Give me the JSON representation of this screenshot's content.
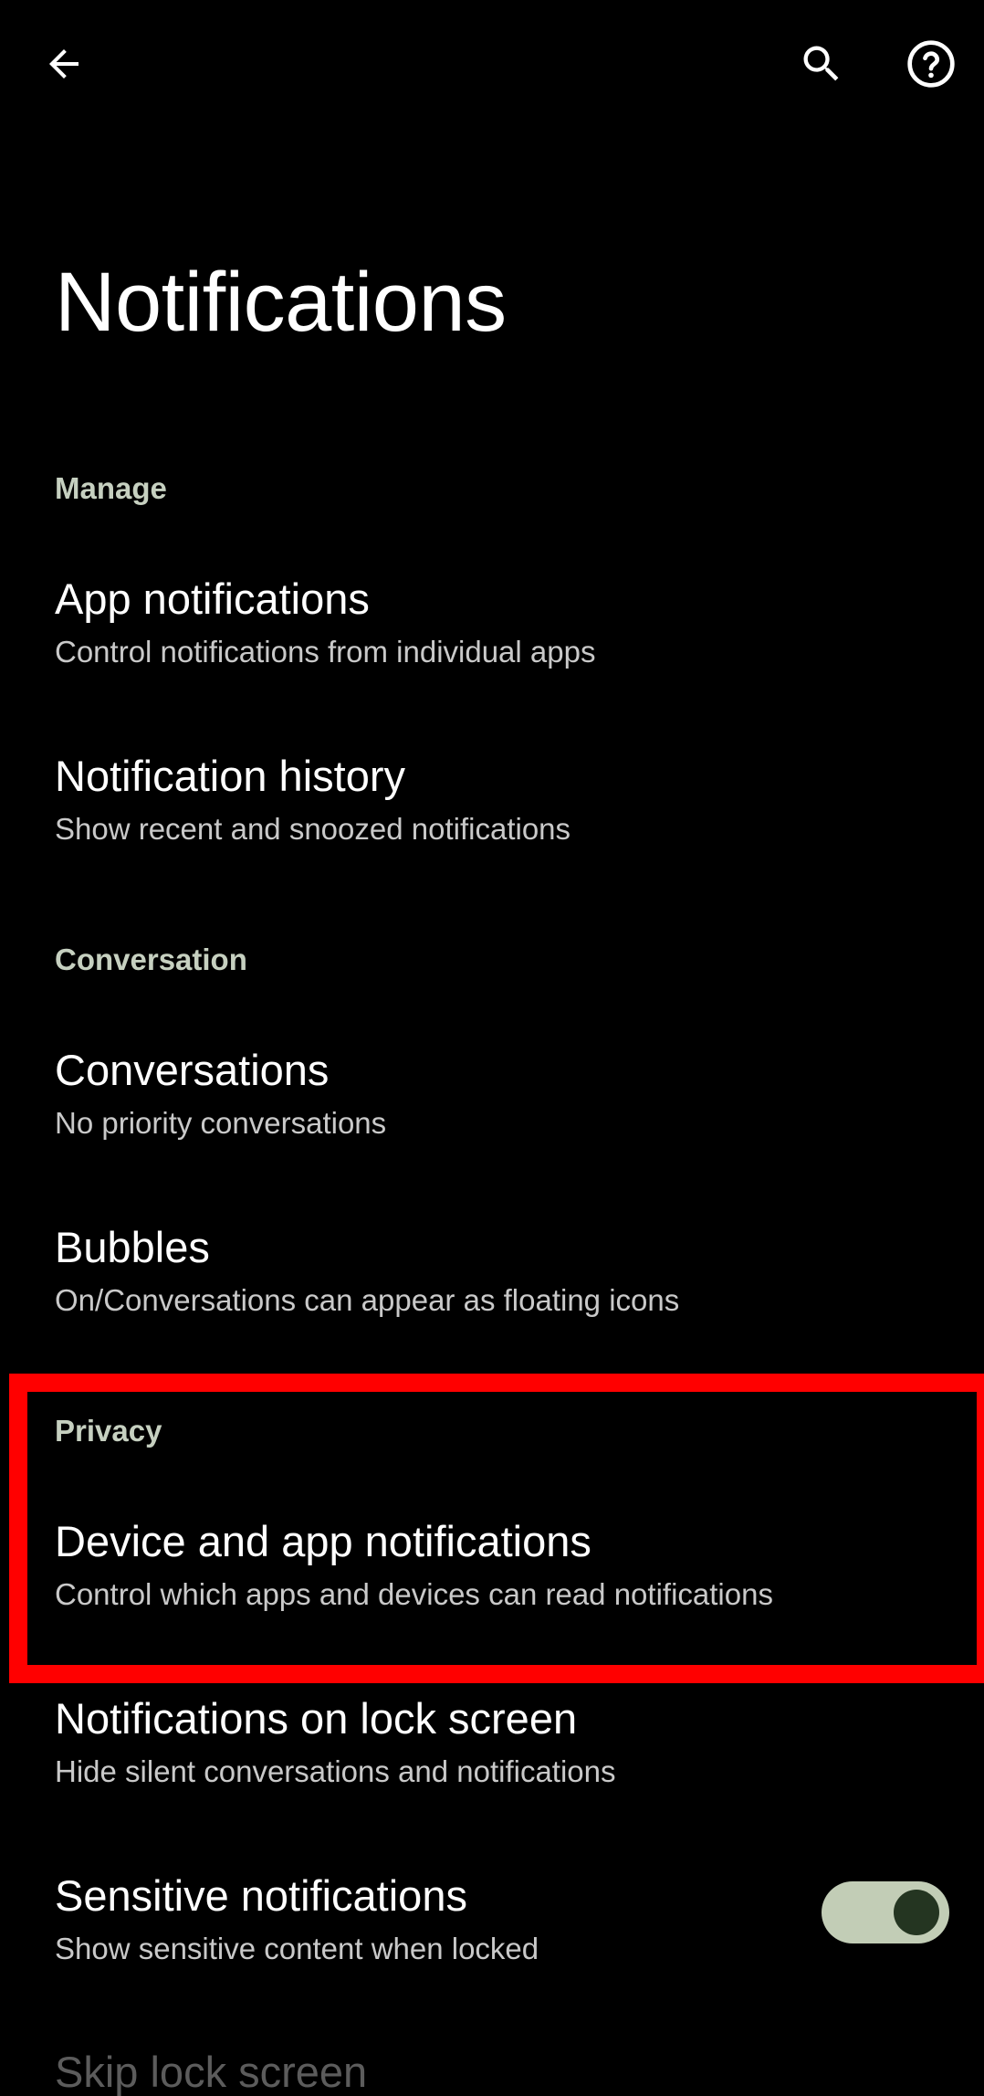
{
  "toolbar": {
    "back_icon": "arrow-back-icon",
    "search_icon": "search-icon",
    "help_icon": "help-circle-icon"
  },
  "page": {
    "title": "Notifications"
  },
  "sections": {
    "manage": {
      "header": "Manage",
      "items": [
        {
          "title": "App notifications",
          "subtitle": "Control notifications from individual apps"
        },
        {
          "title": "Notification history",
          "subtitle": "Show recent and snoozed notifications"
        }
      ]
    },
    "conversation": {
      "header": "Conversation",
      "items": [
        {
          "title": "Conversations",
          "subtitle": "No priority conversations"
        },
        {
          "title": "Bubbles",
          "subtitle": "On/Conversations can appear as floating icons"
        }
      ]
    },
    "privacy": {
      "header": "Privacy",
      "items": [
        {
          "title": "Device and app notifications",
          "subtitle": "Control which apps and devices can read notifications"
        },
        {
          "title": "Notifications on lock screen",
          "subtitle": "Hide silent conversations and notifications"
        },
        {
          "title": "Sensitive notifications",
          "subtitle": "Show sensitive content when locked",
          "toggle_on": true
        },
        {
          "title": "Skip lock screen"
        }
      ]
    }
  },
  "colors": {
    "background": "#000000",
    "section_header": "#c6d0c0",
    "highlight": "#ff0000",
    "toggle_track": "#c2cdb6",
    "toggle_knob": "#243521"
  }
}
